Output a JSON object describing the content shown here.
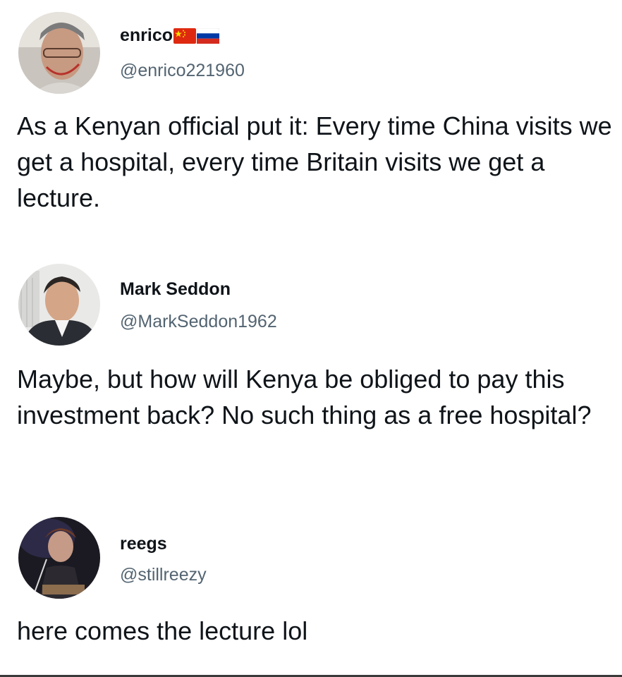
{
  "tweets": [
    {
      "display_name": "enrico",
      "flags": [
        "china-flag-icon",
        "russia-flag-icon"
      ],
      "handle": "@enrico221960",
      "text": "As a Kenyan official put it: Every time China visits we get a hospital, every time Britain visits we get a lecture."
    },
    {
      "display_name": "Mark Seddon",
      "flags": [],
      "handle": "@MarkSeddon1962",
      "text": "Maybe, but how will Kenya be obliged to pay this investment back? No such thing as a free hospital?"
    },
    {
      "display_name": "reegs",
      "flags": [],
      "handle": "@stillreezy",
      "text": "here comes the lecture lol"
    }
  ],
  "colors": {
    "text": "#0f1419",
    "handle": "#536471",
    "background": "#ffffff"
  }
}
